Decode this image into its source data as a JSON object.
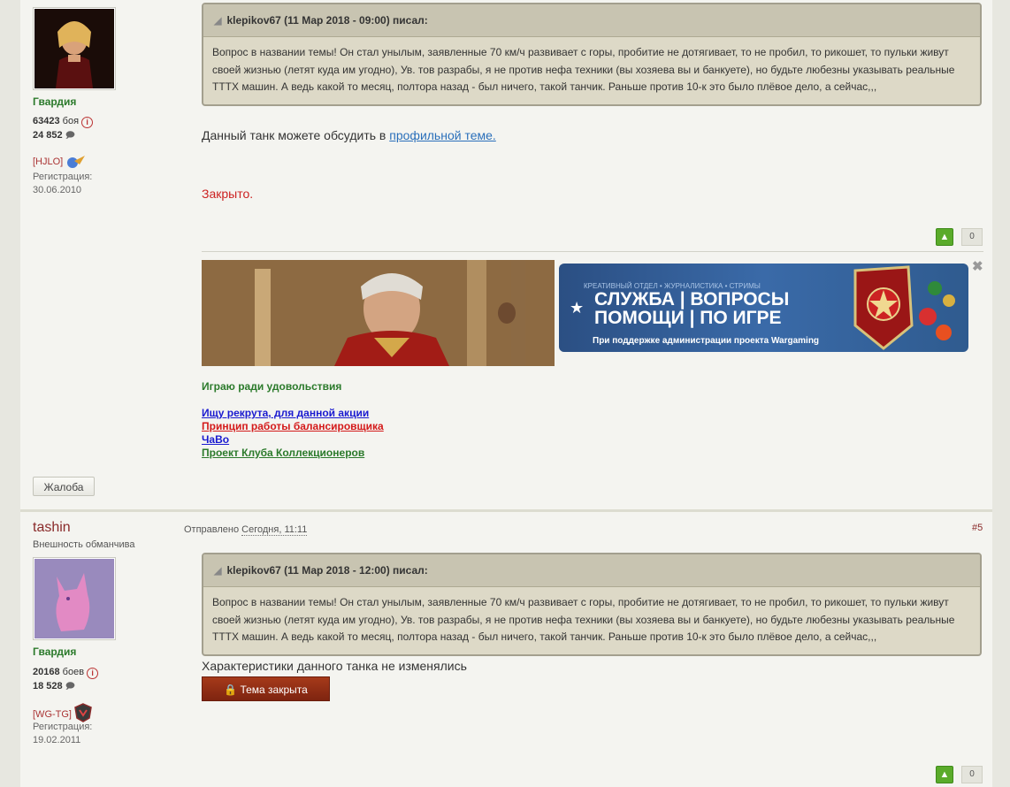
{
  "post1": {
    "user": {
      "group": "Гвардия",
      "battles_num": "63423",
      "battles_label": "боя",
      "messages": "24 852",
      "clan": "[HJLO]",
      "reg_label": "Регистрация:",
      "reg_date": "30.06.2010"
    },
    "quote": {
      "header": "klepikov67 (11 Мар 2018 - 09:00) писал:",
      "body": "Вопрос в названии темы! Он стал унылым, заявленные 70 км/ч развивает с горы, пробитие не дотягивает, то не пробил, то рикошет, то пульки живут своей жизнью (летят куда им угодно), Ув. тов разрабы, я не против нефа техники (вы хозяева вы и банкуете), но будьте любезны указывать реальные ТТТХ машин. А ведь какой то месяц, полтора назад - был ничего, такой танчик. Раньше против 10-к это было плёвое дело, а сейчас,,,"
    },
    "text_prefix": "Данный танк можете обсудить в",
    "text_link": "профильной теме.",
    "closed": "Закрыто.",
    "vote_count": "0",
    "signature": {
      "banner_top": "КРЕАТИВНЫЙ ОТДЕЛ • ЖУРНАЛИСТИКА • СТРИМЫ",
      "banner_line1": "СЛУЖБА | ВОПРОСЫ",
      "banner_line2": "ПОМОЩИ | ПО ИГРЕ",
      "banner_sub": "При поддержке администрации проекта Wargaming",
      "tagline": "Играю ради удовольствия",
      "links": [
        "Ищу рекрута, для данной акции",
        "Принцип работы балансировщика",
        "ЧаВо",
        "Проект Клуба Коллекционеров"
      ]
    },
    "report": "Жалоба"
  },
  "post2": {
    "user": {
      "name": "tashin",
      "title": "Внешность обманчива",
      "group": "Гвардия",
      "battles_num": "20168",
      "battles_label": "боев",
      "messages": "18 528",
      "clan": "[WG-TG]",
      "reg_label": "Регистрация:",
      "reg_date": "19.02.2011"
    },
    "posted_label": "Отправлено",
    "posted_date": "Сегодня, 11:11",
    "post_number": "#5",
    "quote": {
      "header": "klepikov67 (11 Мар 2018 - 12:00) писал:",
      "body": "Вопрос в названии темы! Он стал унылым, заявленные 70 км/ч развивает с горы, пробитие не дотягивает, то не пробил, то рикошет, то пульки живут своей жизнью (летят куда им угодно), Ув. тов разрабы, я не против нефа техники (вы хозяева вы и банкуете), но будьте любезны указывать реальные ТТТХ машин. А ведь какой то месяц, полтора назад - был ничего, такой танчик. Раньше против 10-к это было плёвое дело, а сейчас,,,"
    },
    "text": "Характеристики данного танка не изменялись",
    "closed_button": "Тема закрыта",
    "vote_count": "0"
  },
  "colors": {
    "group": "#2b7a2b",
    "closed_text": "#cc2222",
    "link_blue": "#2a6fba",
    "quote_bg": "#ddd9c7",
    "closed_button": "#8f2e14"
  }
}
